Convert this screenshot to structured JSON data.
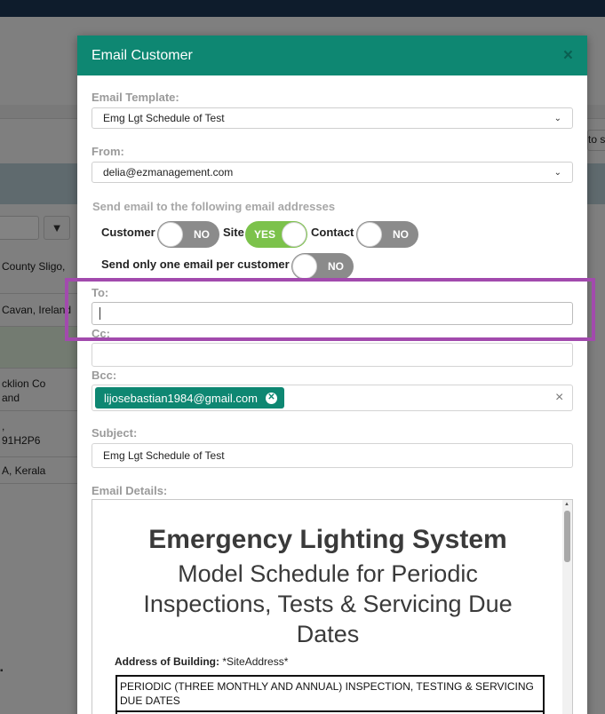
{
  "background": {
    "rows": [
      "County Sligo,",
      "Cavan, Ireland",
      "",
      "cklion Co\nand",
      ",\n91H2P6",
      "A, Kerala"
    ],
    "right_text": "to s"
  },
  "modal": {
    "title": "Email Customer",
    "close": "×",
    "template": {
      "label": "Email Template:",
      "value": "Emg Lgt Schedule of Test"
    },
    "from": {
      "label": "From:",
      "value": "delia@ezmanagement.com"
    },
    "send_to_label": "Send email to the following email addresses",
    "toggles": [
      {
        "label": "Customer",
        "state": "NO"
      },
      {
        "label": "Site",
        "state": "YES"
      },
      {
        "label": "Contact",
        "state": "NO"
      }
    ],
    "one_email": {
      "label": "Send only one email per customer",
      "state": "NO"
    },
    "to": {
      "label": "To:",
      "value": ""
    },
    "cc": {
      "label": "Cc:",
      "value": ""
    },
    "bcc": {
      "label": "Bcc:",
      "tag": "lijosebastian1984@gmail.com",
      "clear": "×"
    },
    "subject": {
      "label": "Subject:",
      "value": "Emg Lgt Schedule of Test"
    },
    "details_label": "Email Details:",
    "document": {
      "heading": "Emergency Lighting System",
      "subheading": "Model Schedule for Periodic Inspections, Tests & Servicing Due Dates",
      "address_label": "Address of Building:",
      "address_value": "*SiteAddress*",
      "table_header": "PERIODIC (THREE MONTHLY AND ANNUAL) INSPECTION, TESTING & SERVICING DUE DATES"
    }
  },
  "colors": {
    "header": "#0e8772",
    "toggle_on": "#7cc24b",
    "toggle_off": "#8b8b8b",
    "highlight": "#a24aad"
  }
}
